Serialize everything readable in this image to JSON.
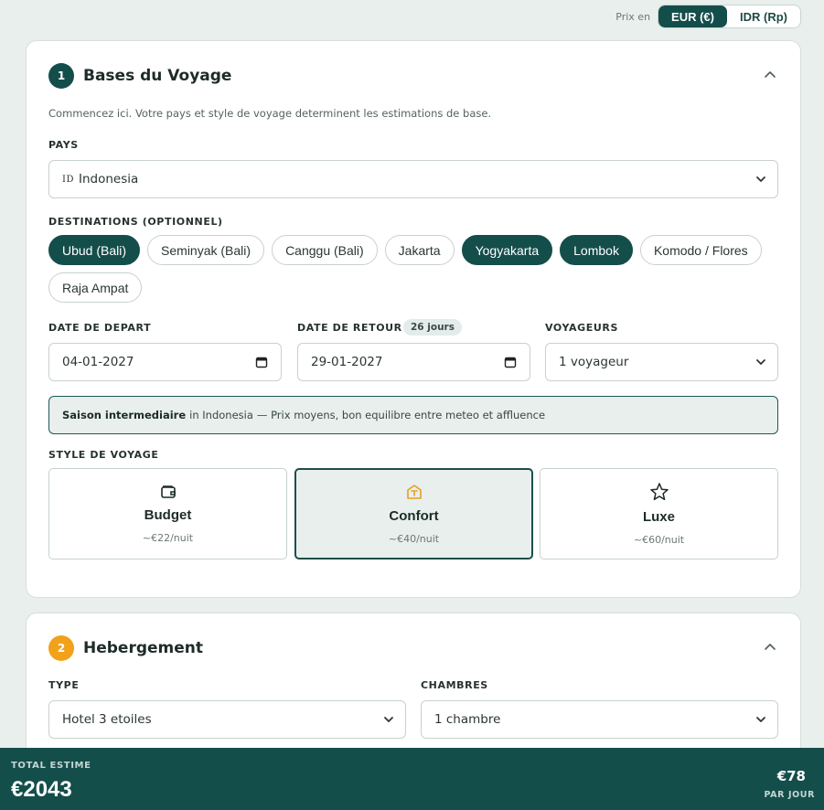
{
  "currency": {
    "label": "Prix en",
    "options": [
      "EUR (€)",
      "IDR (Rp)"
    ],
    "selected": "EUR (€)"
  },
  "section1": {
    "step": "1",
    "title": "Bases du Voyage",
    "intro": "Commencez ici. Votre pays et style de voyage determinent les estimations de base.",
    "country_label": "PAYS",
    "country_code": "ID",
    "country_value": "Indonesia",
    "destinations_label": "DESTINATIONS (OPTIONNEL)",
    "destinations": [
      {
        "label": "Ubud (Bali)",
        "selected": true
      },
      {
        "label": "Seminyak (Bali)",
        "selected": false
      },
      {
        "label": "Canggu (Bali)",
        "selected": false
      },
      {
        "label": "Jakarta",
        "selected": false
      },
      {
        "label": "Yogyakarta",
        "selected": true
      },
      {
        "label": "Lombok",
        "selected": true
      },
      {
        "label": "Komodo / Flores",
        "selected": false
      },
      {
        "label": "Raja Ampat",
        "selected": false
      }
    ],
    "depart_label": "DATE DE DEPART",
    "depart_value": "04-01-2027",
    "return_label": "DATE DE RETOUR",
    "return_value": "29-01-2027",
    "days_badge": "26 jours",
    "travelers_label": "VOYAGEURS",
    "travelers_value": "1 voyageur",
    "season_bold": "Saison intermediaire",
    "season_in": "in Indonesia",
    "season_rest": "— Prix moyens, bon equilibre entre meteo et affluence",
    "style_label": "STYLE DE VOYAGE",
    "styles": [
      {
        "name": "Budget",
        "price": "~€22/nuit",
        "icon": "wallet-icon",
        "selected": false
      },
      {
        "name": "Confort",
        "price": "~€40/nuit",
        "icon": "home-icon",
        "selected": true
      },
      {
        "name": "Luxe",
        "price": "~€60/nuit",
        "icon": "star-icon",
        "selected": false
      }
    ]
  },
  "section2": {
    "step": "2",
    "title": "Hebergement",
    "type_label": "TYPE",
    "type_value": "Hotel 3 etoiles",
    "rooms_label": "CHAMBRES",
    "rooms_value": "1 chambre"
  },
  "footer": {
    "total_label": "TOTAL ESTIME",
    "total_value": "€2043",
    "per_day_value": "€78",
    "per_day_label": "PAR JOUR"
  },
  "colors": {
    "primary": "#144e4b",
    "accent": "#f2a11b",
    "background": "#e8efec"
  }
}
